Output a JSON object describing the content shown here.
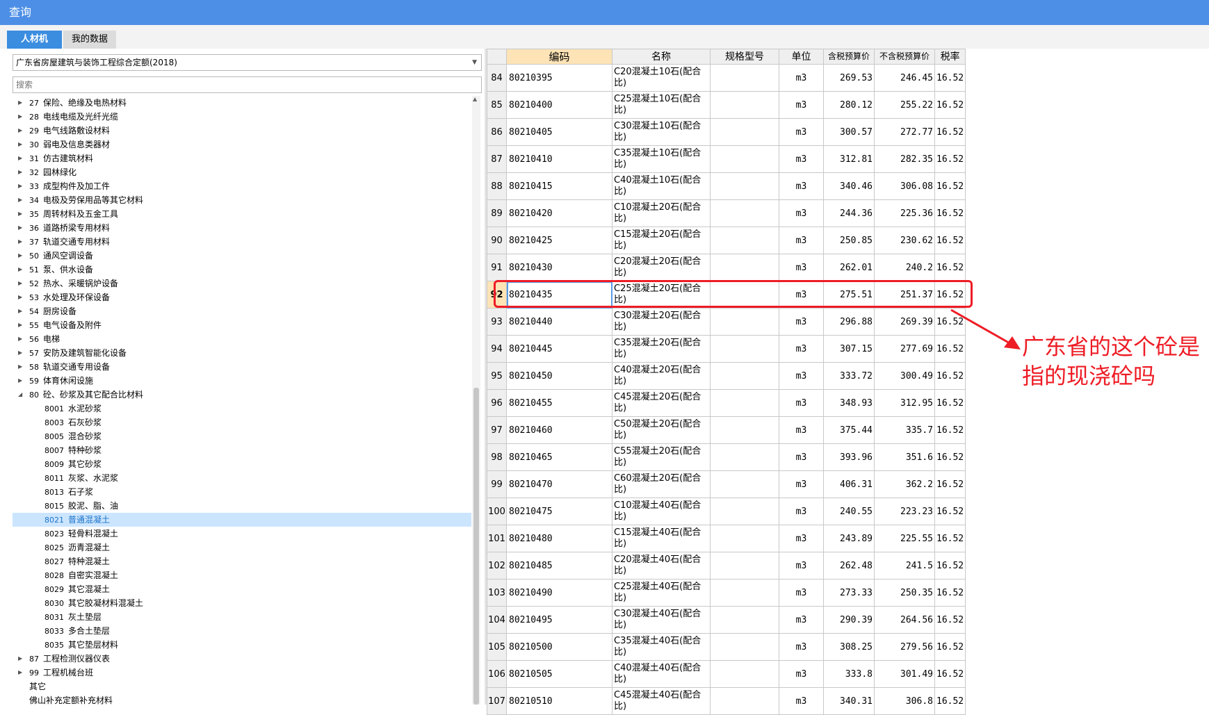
{
  "window": {
    "title": "查询"
  },
  "tabs": [
    {
      "label": "人材机",
      "active": true
    },
    {
      "label": "我的数据",
      "active": false
    }
  ],
  "library_select": {
    "value": "广东省房屋建筑与装饰工程综合定额(2018)"
  },
  "search": {
    "placeholder": "搜索"
  },
  "tree": [
    {
      "code": "27",
      "label": "保险、绝缘及电热材料",
      "level": 0,
      "expandable": true,
      "expanded": false
    },
    {
      "code": "28",
      "label": "电线电缆及光纤光缆",
      "level": 0,
      "expandable": true,
      "expanded": false
    },
    {
      "code": "29",
      "label": "电气线路敷设材料",
      "level": 0,
      "expandable": true,
      "expanded": false
    },
    {
      "code": "30",
      "label": "弱电及信息类器材",
      "level": 0,
      "expandable": true,
      "expanded": false
    },
    {
      "code": "31",
      "label": "仿古建筑材料",
      "level": 0,
      "expandable": true,
      "expanded": false
    },
    {
      "code": "32",
      "label": "园林绿化",
      "level": 0,
      "expandable": true,
      "expanded": false
    },
    {
      "code": "33",
      "label": "成型构件及加工件",
      "level": 0,
      "expandable": true,
      "expanded": false
    },
    {
      "code": "34",
      "label": "电极及劳保用品等其它材料",
      "level": 0,
      "expandable": true,
      "expanded": false
    },
    {
      "code": "35",
      "label": "周转材料及五金工具",
      "level": 0,
      "expandable": true,
      "expanded": false
    },
    {
      "code": "36",
      "label": "道路桥梁专用材料",
      "level": 0,
      "expandable": true,
      "expanded": false
    },
    {
      "code": "37",
      "label": "轨道交通专用材料",
      "level": 0,
      "expandable": true,
      "expanded": false
    },
    {
      "code": "50",
      "label": "通风空调设备",
      "level": 0,
      "expandable": true,
      "expanded": false
    },
    {
      "code": "51",
      "label": "泵、供水设备",
      "level": 0,
      "expandable": true,
      "expanded": false
    },
    {
      "code": "52",
      "label": "热水、采暖锅炉设备",
      "level": 0,
      "expandable": true,
      "expanded": false
    },
    {
      "code": "53",
      "label": "水处理及环保设备",
      "level": 0,
      "expandable": true,
      "expanded": false
    },
    {
      "code": "54",
      "label": "厨房设备",
      "level": 0,
      "expandable": true,
      "expanded": false
    },
    {
      "code": "55",
      "label": "电气设备及附件",
      "level": 0,
      "expandable": true,
      "expanded": false
    },
    {
      "code": "56",
      "label": "电梯",
      "level": 0,
      "expandable": true,
      "expanded": false
    },
    {
      "code": "57",
      "label": "安防及建筑智能化设备",
      "level": 0,
      "expandable": true,
      "expanded": false
    },
    {
      "code": "58",
      "label": "轨道交通专用设备",
      "level": 0,
      "expandable": true,
      "expanded": false
    },
    {
      "code": "59",
      "label": "体育休闲设施",
      "level": 0,
      "expandable": true,
      "expanded": false
    },
    {
      "code": "80",
      "label": "砼、砂浆及其它配合比材料",
      "level": 0,
      "expandable": true,
      "expanded": true
    },
    {
      "code": "8001",
      "label": "水泥砂浆",
      "level": 1,
      "expandable": false
    },
    {
      "code": "8003",
      "label": "石灰砂浆",
      "level": 1,
      "expandable": false
    },
    {
      "code": "8005",
      "label": "混合砂浆",
      "level": 1,
      "expandable": false
    },
    {
      "code": "8007",
      "label": "特种砂浆",
      "level": 1,
      "expandable": false
    },
    {
      "code": "8009",
      "label": "其它砂浆",
      "level": 1,
      "expandable": false
    },
    {
      "code": "8011",
      "label": "灰浆、水泥浆",
      "level": 1,
      "expandable": false
    },
    {
      "code": "8013",
      "label": "石子浆",
      "level": 1,
      "expandable": false
    },
    {
      "code": "8015",
      "label": "胶泥、脂、油",
      "level": 1,
      "expandable": false
    },
    {
      "code": "8021",
      "label": "普通混凝土",
      "level": 1,
      "expandable": false,
      "selected": true
    },
    {
      "code": "8023",
      "label": "轻骨料混凝土",
      "level": 1,
      "expandable": false
    },
    {
      "code": "8025",
      "label": "沥青混凝土",
      "level": 1,
      "expandable": false
    },
    {
      "code": "8027",
      "label": "特种混凝土",
      "level": 1,
      "expandable": false
    },
    {
      "code": "8028",
      "label": "自密实混凝土",
      "level": 1,
      "expandable": false
    },
    {
      "code": "8029",
      "label": "其它混凝土",
      "level": 1,
      "expandable": false
    },
    {
      "code": "8030",
      "label": "其它胶凝材料混凝土",
      "level": 1,
      "expandable": false
    },
    {
      "code": "8031",
      "label": "灰土垫层",
      "level": 1,
      "expandable": false
    },
    {
      "code": "8033",
      "label": "多合土垫层",
      "level": 1,
      "expandable": false
    },
    {
      "code": "8035",
      "label": "其它垫层材料",
      "level": 1,
      "expandable": false
    },
    {
      "code": "87",
      "label": "工程检测仪器仪表",
      "level": 0,
      "expandable": true,
      "expanded": false
    },
    {
      "code": "99",
      "label": "工程机械台班",
      "level": 0,
      "expandable": true,
      "expanded": false
    },
    {
      "code": "",
      "label": "其它",
      "level": 0,
      "expandable": false
    },
    {
      "code": "",
      "label": "佛山补充定额补充材料",
      "level": 0,
      "expandable": false
    }
  ],
  "table": {
    "columns": [
      "编码",
      "名称",
      "规格型号",
      "单位",
      "含税预算价",
      "不含税预算价",
      "税率"
    ],
    "rows": [
      {
        "no": "84",
        "code": "80210395",
        "name": "C20混凝土10石(配合比)",
        "spec": "",
        "unit": "m3",
        "tax_price": "269.53",
        "notax_price": "246.45",
        "rate": "16.52"
      },
      {
        "no": "85",
        "code": "80210400",
        "name": "C25混凝土10石(配合比)",
        "spec": "",
        "unit": "m3",
        "tax_price": "280.12",
        "notax_price": "255.22",
        "rate": "16.52"
      },
      {
        "no": "86",
        "code": "80210405",
        "name": "C30混凝土10石(配合比)",
        "spec": "",
        "unit": "m3",
        "tax_price": "300.57",
        "notax_price": "272.77",
        "rate": "16.52"
      },
      {
        "no": "87",
        "code": "80210410",
        "name": "C35混凝土10石(配合比)",
        "spec": "",
        "unit": "m3",
        "tax_price": "312.81",
        "notax_price": "282.35",
        "rate": "16.52"
      },
      {
        "no": "88",
        "code": "80210415",
        "name": "C40混凝土10石(配合比)",
        "spec": "",
        "unit": "m3",
        "tax_price": "340.46",
        "notax_price": "306.08",
        "rate": "16.52"
      },
      {
        "no": "89",
        "code": "80210420",
        "name": "C10混凝土20石(配合比)",
        "spec": "",
        "unit": "m3",
        "tax_price": "244.36",
        "notax_price": "225.36",
        "rate": "16.52"
      },
      {
        "no": "90",
        "code": "80210425",
        "name": "C15混凝土20石(配合比)",
        "spec": "",
        "unit": "m3",
        "tax_price": "250.85",
        "notax_price": "230.62",
        "rate": "16.52"
      },
      {
        "no": "91",
        "code": "80210430",
        "name": "C20混凝土20石(配合比)",
        "spec": "",
        "unit": "m3",
        "tax_price": "262.01",
        "notax_price": "240.2",
        "rate": "16.52"
      },
      {
        "no": "92",
        "code": "80210435",
        "name": "C25混凝土20石(配合比)",
        "spec": "",
        "unit": "m3",
        "tax_price": "275.51",
        "notax_price": "251.37",
        "rate": "16.52",
        "active": true
      },
      {
        "no": "93",
        "code": "80210440",
        "name": "C30混凝土20石(配合比)",
        "spec": "",
        "unit": "m3",
        "tax_price": "296.88",
        "notax_price": "269.39",
        "rate": "16.52"
      },
      {
        "no": "94",
        "code": "80210445",
        "name": "C35混凝土20石(配合比)",
        "spec": "",
        "unit": "m3",
        "tax_price": "307.15",
        "notax_price": "277.69",
        "rate": "16.52"
      },
      {
        "no": "95",
        "code": "80210450",
        "name": "C40混凝土20石(配合比)",
        "spec": "",
        "unit": "m3",
        "tax_price": "333.72",
        "notax_price": "300.49",
        "rate": "16.52"
      },
      {
        "no": "96",
        "code": "80210455",
        "name": "C45混凝土20石(配合比)",
        "spec": "",
        "unit": "m3",
        "tax_price": "348.93",
        "notax_price": "312.95",
        "rate": "16.52"
      },
      {
        "no": "97",
        "code": "80210460",
        "name": "C50混凝土20石(配合比)",
        "spec": "",
        "unit": "m3",
        "tax_price": "375.44",
        "notax_price": "335.7",
        "rate": "16.52"
      },
      {
        "no": "98",
        "code": "80210465",
        "name": "C55混凝土20石(配合比)",
        "spec": "",
        "unit": "m3",
        "tax_price": "393.96",
        "notax_price": "351.6",
        "rate": "16.52"
      },
      {
        "no": "99",
        "code": "80210470",
        "name": "C60混凝土20石(配合比)",
        "spec": "",
        "unit": "m3",
        "tax_price": "406.31",
        "notax_price": "362.2",
        "rate": "16.52"
      },
      {
        "no": "100",
        "code": "80210475",
        "name": "C10混凝土40石(配合比)",
        "spec": "",
        "unit": "m3",
        "tax_price": "240.55",
        "notax_price": "223.23",
        "rate": "16.52"
      },
      {
        "no": "101",
        "code": "80210480",
        "name": "C15混凝土40石(配合比)",
        "spec": "",
        "unit": "m3",
        "tax_price": "243.89",
        "notax_price": "225.55",
        "rate": "16.52"
      },
      {
        "no": "102",
        "code": "80210485",
        "name": "C20混凝土40石(配合比)",
        "spec": "",
        "unit": "m3",
        "tax_price": "262.48",
        "notax_price": "241.5",
        "rate": "16.52"
      },
      {
        "no": "103",
        "code": "80210490",
        "name": "C25混凝土40石(配合比)",
        "spec": "",
        "unit": "m3",
        "tax_price": "273.33",
        "notax_price": "250.35",
        "rate": "16.52"
      },
      {
        "no": "104",
        "code": "80210495",
        "name": "C30混凝土40石(配合比)",
        "spec": "",
        "unit": "m3",
        "tax_price": "290.39",
        "notax_price": "264.56",
        "rate": "16.52"
      },
      {
        "no": "105",
        "code": "80210500",
        "name": "C35混凝土40石(配合比)",
        "spec": "",
        "unit": "m3",
        "tax_price": "308.25",
        "notax_price": "279.56",
        "rate": "16.52"
      },
      {
        "no": "106",
        "code": "80210505",
        "name": "C40混凝土40石(配合比)",
        "spec": "",
        "unit": "m3",
        "tax_price": "333.8",
        "notax_price": "301.49",
        "rate": "16.52"
      },
      {
        "no": "107",
        "code": "80210510",
        "name": "C45混凝土40石(配合比)",
        "spec": "",
        "unit": "m3",
        "tax_price": "340.31",
        "notax_price": "306.8",
        "rate": "16.52"
      }
    ]
  },
  "annotation": {
    "text": "广东省的这个砼是指的现浇砼吗",
    "color": "#ee1c25"
  }
}
